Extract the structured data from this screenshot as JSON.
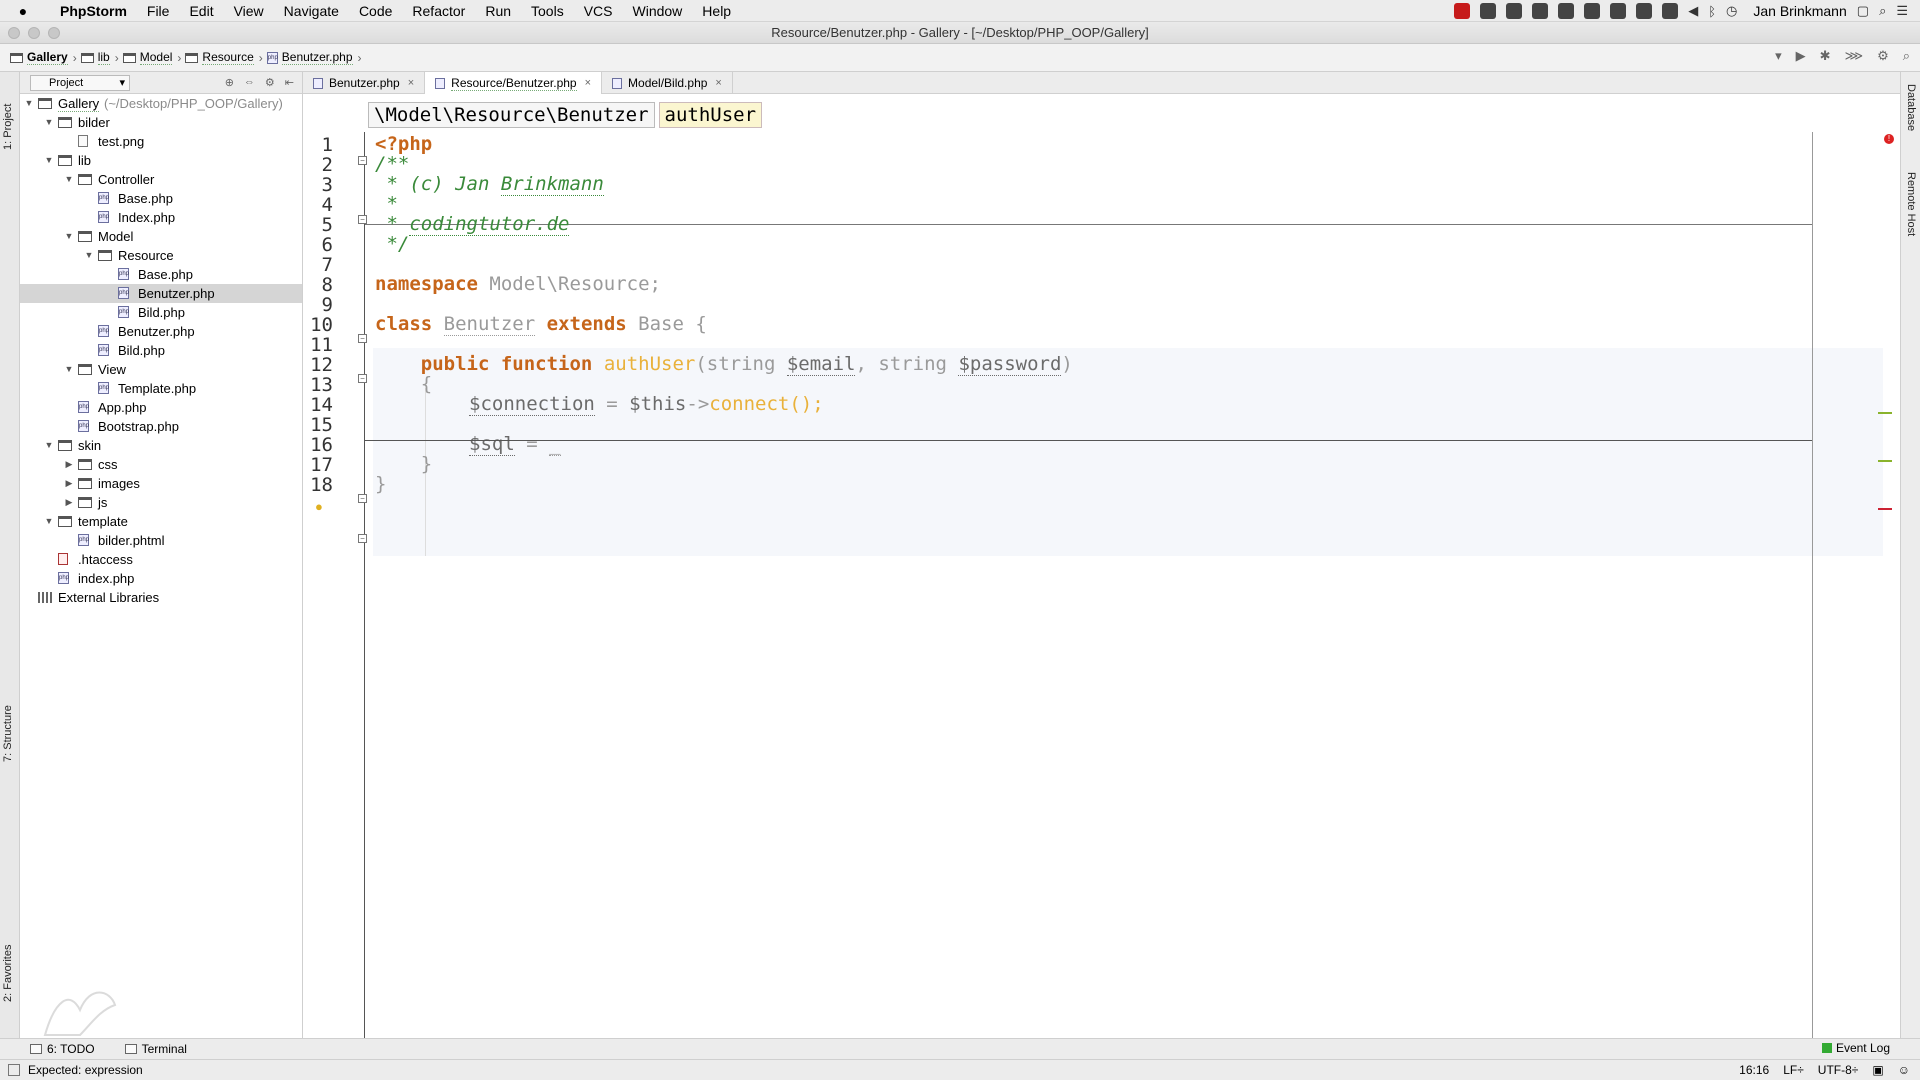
{
  "menubar": {
    "app": "PhpStorm",
    "items": [
      "File",
      "Edit",
      "View",
      "Navigate",
      "Code",
      "Refactor",
      "Run",
      "Tools",
      "VCS",
      "Window",
      "Help"
    ],
    "user": "Jan Brinkmann"
  },
  "window": {
    "title": "Resource/Benutzer.php - Gallery - [~/Desktop/PHP_OOP/Gallery]"
  },
  "navbar": {
    "crumbs": [
      "Gallery",
      "lib",
      "Model",
      "Resource",
      "Benutzer.php"
    ]
  },
  "project": {
    "selector": "Project",
    "rows": [
      {
        "name": "Gallery",
        "path": "(~/Desktop/PHP_OOP/Gallery)",
        "type": "dir",
        "level": 0,
        "open": true
      },
      {
        "name": "bilder",
        "type": "dir",
        "level": 1,
        "open": true
      },
      {
        "name": "test.png",
        "type": "png",
        "level": 2
      },
      {
        "name": "lib",
        "type": "dir",
        "level": 1,
        "open": true
      },
      {
        "name": "Controller",
        "type": "dir",
        "level": 2,
        "open": true
      },
      {
        "name": "Base.php",
        "type": "php",
        "level": 3
      },
      {
        "name": "Index.php",
        "type": "php",
        "level": 3
      },
      {
        "name": "Model",
        "type": "dir",
        "level": 2,
        "open": true
      },
      {
        "name": "Resource",
        "type": "dir",
        "level": 3,
        "open": true
      },
      {
        "name": "Base.php",
        "type": "php",
        "level": 4
      },
      {
        "name": "Benutzer.php",
        "type": "php",
        "level": 4,
        "selected": true
      },
      {
        "name": "Bild.php",
        "type": "php",
        "level": 4
      },
      {
        "name": "Benutzer.php",
        "type": "php",
        "level": 3
      },
      {
        "name": "Bild.php",
        "type": "php",
        "level": 3
      },
      {
        "name": "View",
        "type": "dir",
        "level": 2,
        "open": true
      },
      {
        "name": "Template.php",
        "type": "php",
        "level": 3
      },
      {
        "name": "App.php",
        "type": "php",
        "level": 2
      },
      {
        "name": "Bootstrap.php",
        "type": "php",
        "level": 2
      },
      {
        "name": "skin",
        "type": "dir",
        "level": 1,
        "open": true
      },
      {
        "name": "css",
        "type": "dir",
        "level": 2,
        "open": false
      },
      {
        "name": "images",
        "type": "dir",
        "level": 2,
        "open": false
      },
      {
        "name": "js",
        "type": "dir",
        "level": 2,
        "open": false
      },
      {
        "name": "template",
        "type": "dir",
        "level": 1,
        "open": true
      },
      {
        "name": "bilder.phtml",
        "type": "php",
        "level": 2
      },
      {
        "name": ".htaccess",
        "type": "ht",
        "level": 1
      },
      {
        "name": "index.php",
        "type": "php",
        "level": 1
      },
      {
        "name": "External Libraries",
        "type": "lib",
        "level": 0
      }
    ]
  },
  "tabs": [
    {
      "label": "Benutzer.php",
      "active": false
    },
    {
      "label": "Resource/Benutzer.php",
      "active": true
    },
    {
      "label": "Model/Bild.php",
      "active": false
    }
  ],
  "editor": {
    "breadcrumb": [
      "\\Model\\Resource\\Benutzer",
      "authUser"
    ],
    "line_numbers": [
      "1",
      "2",
      "3",
      "4",
      "5",
      "6",
      "7",
      "8",
      "9",
      "10",
      "11",
      "12",
      "13",
      "14",
      "15",
      "16",
      "17",
      "18"
    ],
    "lines": {
      "l1": "<?php",
      "l2": "/**",
      "l3_a": " * ",
      "l3_b": "(c) Jan ",
      "l3_c": "Brinkmann",
      "l4": " *",
      "l5_a": " * ",
      "l5_b": "codingtutor.de",
      "l6": " */",
      "l8_kw": "namespace",
      "l8_rest": " Model\\Resource;",
      "l10_kw1": "class",
      "l10_sp1": " ",
      "l10_name": "Benutzer",
      "l10_sp2": " ",
      "l10_kw2": "extends",
      "l10_rest": " Base {",
      "l12_kw1": "    public",
      "l12_sp": " ",
      "l12_kw2": "function",
      "l12_sp2": " ",
      "l12_fn": "authUser",
      "l12_p1": "(string ",
      "l12_v1": "$email",
      "l12_p2": ", string ",
      "l12_v2": "$password",
      "l12_p3": ")",
      "l13": "    {",
      "l14_v": "$connection",
      "l14_eq": " = ",
      "l14_this": "$this",
      "l14_arr": "->",
      "l14_fn": "connect",
      "l14_end": "();",
      "l16_v": "$sql",
      "l16_eq": " = ",
      "l16_end": "_",
      "l17": "    }",
      "l18": "}"
    }
  },
  "toolwindows": {
    "left_top": "1: Project",
    "left_mid": "7: Structure",
    "left_bot": "2: Favorites",
    "right_top": "Database",
    "right_mid": "Remote Host"
  },
  "bottom": {
    "todo": "6: TODO",
    "terminal": "Terminal",
    "event_log": "Event Log"
  },
  "status": {
    "message": "Expected: expression",
    "position": "16:16",
    "line_sep": "LF÷",
    "encoding": "UTF-8÷"
  }
}
